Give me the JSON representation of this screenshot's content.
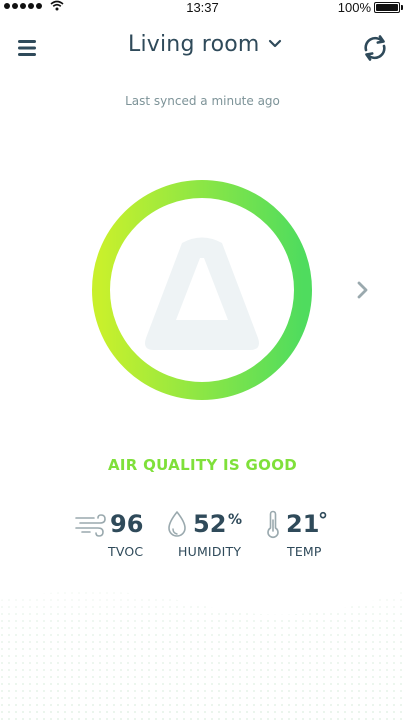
{
  "status_bar": {
    "time": "13:37",
    "battery": "100%"
  },
  "header": {
    "title": "Living room",
    "sync_text": "Last synced a minute ago"
  },
  "air_quality": {
    "status": "AIR QUALITY IS GOOD",
    "score_fraction": 1.0,
    "colors": {
      "start": "#c8f02c",
      "end": "#4fdc5e",
      "status_text": "#7fe03a"
    }
  },
  "metrics": {
    "tvoc": {
      "value": "96",
      "label": "TVOC",
      "icon": "wind-icon"
    },
    "humidity": {
      "value": "52",
      "unit": "%",
      "label": "HUMIDITY",
      "icon": "droplet-icon"
    },
    "temp": {
      "value": "21",
      "unit": "°",
      "label": "TEMP",
      "icon": "thermometer-icon"
    }
  },
  "colors": {
    "text": "#2f4a5a",
    "muted": "#7d9398"
  }
}
